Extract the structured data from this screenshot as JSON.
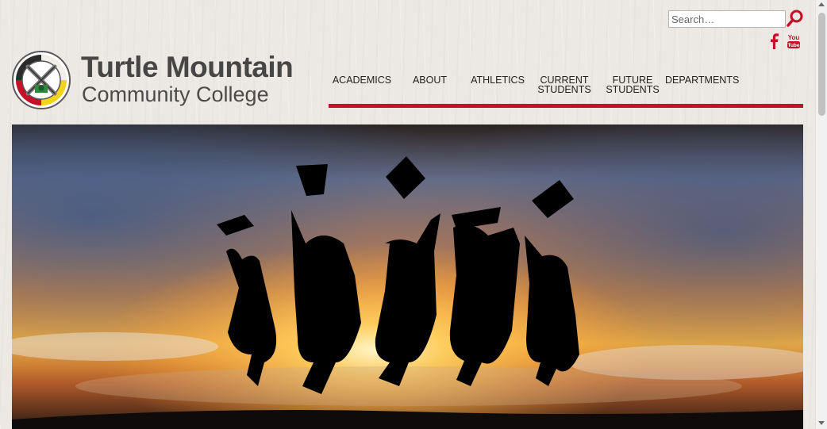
{
  "search": {
    "placeholder": "Search…"
  },
  "social": {
    "facebook_icon": "facebook-icon",
    "youtube_icon": "youtube-icon",
    "youtube_glyph_top": "You",
    "youtube_glyph_bottom": "Tube"
  },
  "logo": {
    "line1": "Turtle Mountain",
    "line2": "Community College"
  },
  "nav": {
    "items": [
      {
        "label": "ACADEMICS"
      },
      {
        "label": "ABOUT"
      },
      {
        "label": "ATHLETICS"
      },
      {
        "label": "CURRENT",
        "label2": "STUDENTS"
      },
      {
        "label": "FUTURE",
        "label2": "STUDENTS"
      },
      {
        "label": "DEPARTMENTS"
      }
    ]
  },
  "colors": {
    "accent": "#c5102a",
    "logo_text": "#464646",
    "background": "#ece8e4"
  },
  "hero": {
    "image": "graduates-jumping-at-sunset"
  }
}
